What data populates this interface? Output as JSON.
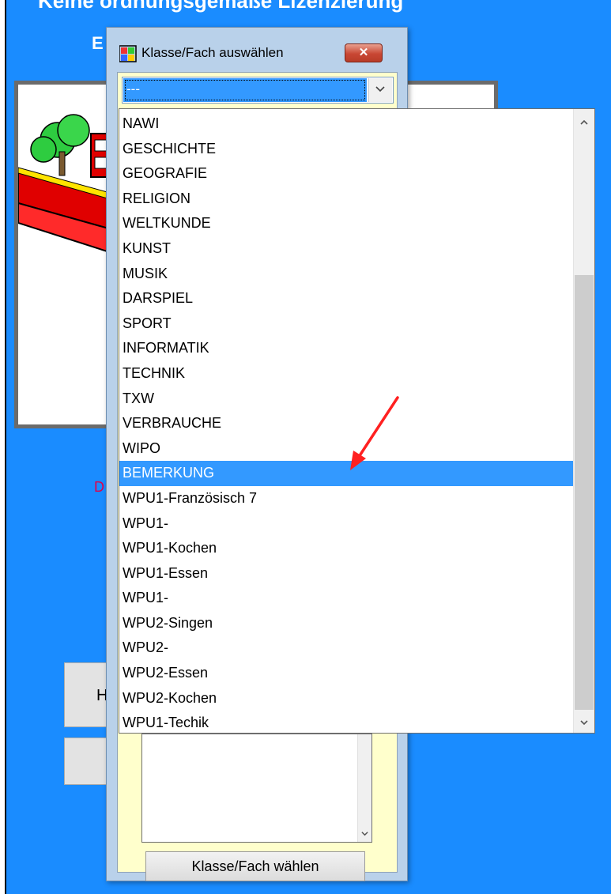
{
  "background": {
    "title_text": "Keine ordnungsgemäße Lizenzierung",
    "e_letter": "E",
    "d_letter": "D",
    "h_letter": "H"
  },
  "dialog": {
    "title": "Klasse/Fach auswählen",
    "close_label": "✕",
    "combo_value": "---",
    "choose_button_label": "Klasse/Fach wählen"
  },
  "dropdown": {
    "items": [
      "NAWI",
      "GESCHICHTE",
      "GEOGRAFIE",
      "RELIGION",
      "WELTKUNDE",
      "KUNST",
      "MUSIK",
      "DARSPIEL",
      "SPORT",
      "INFORMATIK",
      "TECHNIK",
      "TXW",
      "VERBRAUCHE",
      "WIPO",
      "BEMERKUNG",
      "WPU1-Französisch 7",
      "WPU1-",
      "WPU1-Kochen",
      "WPU1-Essen",
      "WPU1-",
      "WPU2-Singen",
      "WPU2-",
      "WPU2-Essen",
      "WPU2-Kochen",
      "WPU1-Techik"
    ],
    "selected_item": "BEMERKUNG"
  },
  "colors": {
    "app_background": "#1a8cff",
    "selection": "#3399ff",
    "dialog_body": "#ffffcc",
    "annotation_arrow": "#ff2020"
  },
  "icons": {
    "dialog_icon": "app-icon",
    "combo_button": "chevron-down-icon",
    "scroll_up": "chevron-up-icon",
    "scroll_down": "chevron-down-icon"
  }
}
